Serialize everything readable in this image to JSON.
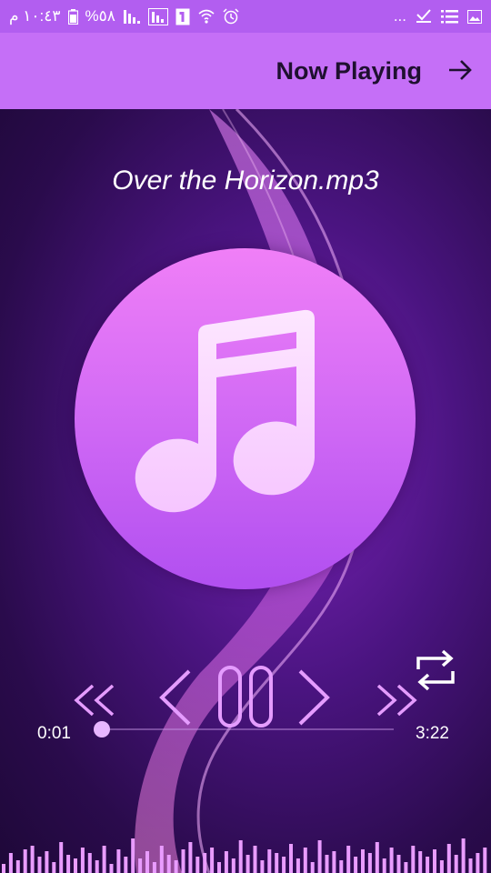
{
  "status_bar": {
    "time": "١٠:٤٣ م",
    "battery": "%٥٨",
    "overflow": "..."
  },
  "app_bar": {
    "title": "Now Playing",
    "forward_icon": "arrow-right-icon"
  },
  "player": {
    "track_title": "Over the Horizon.mp3",
    "current_time": "0:01",
    "total_time": "3:22",
    "progress_fraction": 0.005,
    "artwork_icon": "music-note-icon",
    "repeat_icon": "repeat-icon",
    "controls": [
      "rewind-icon",
      "previous-icon",
      "pause-icon",
      "next-icon",
      "fast-forward-icon"
    ]
  },
  "theme": {
    "status_bar": "#b25ef0",
    "app_bar": "#c56ff7",
    "accent": "#e8a0ff",
    "background": "#3a0f66"
  }
}
